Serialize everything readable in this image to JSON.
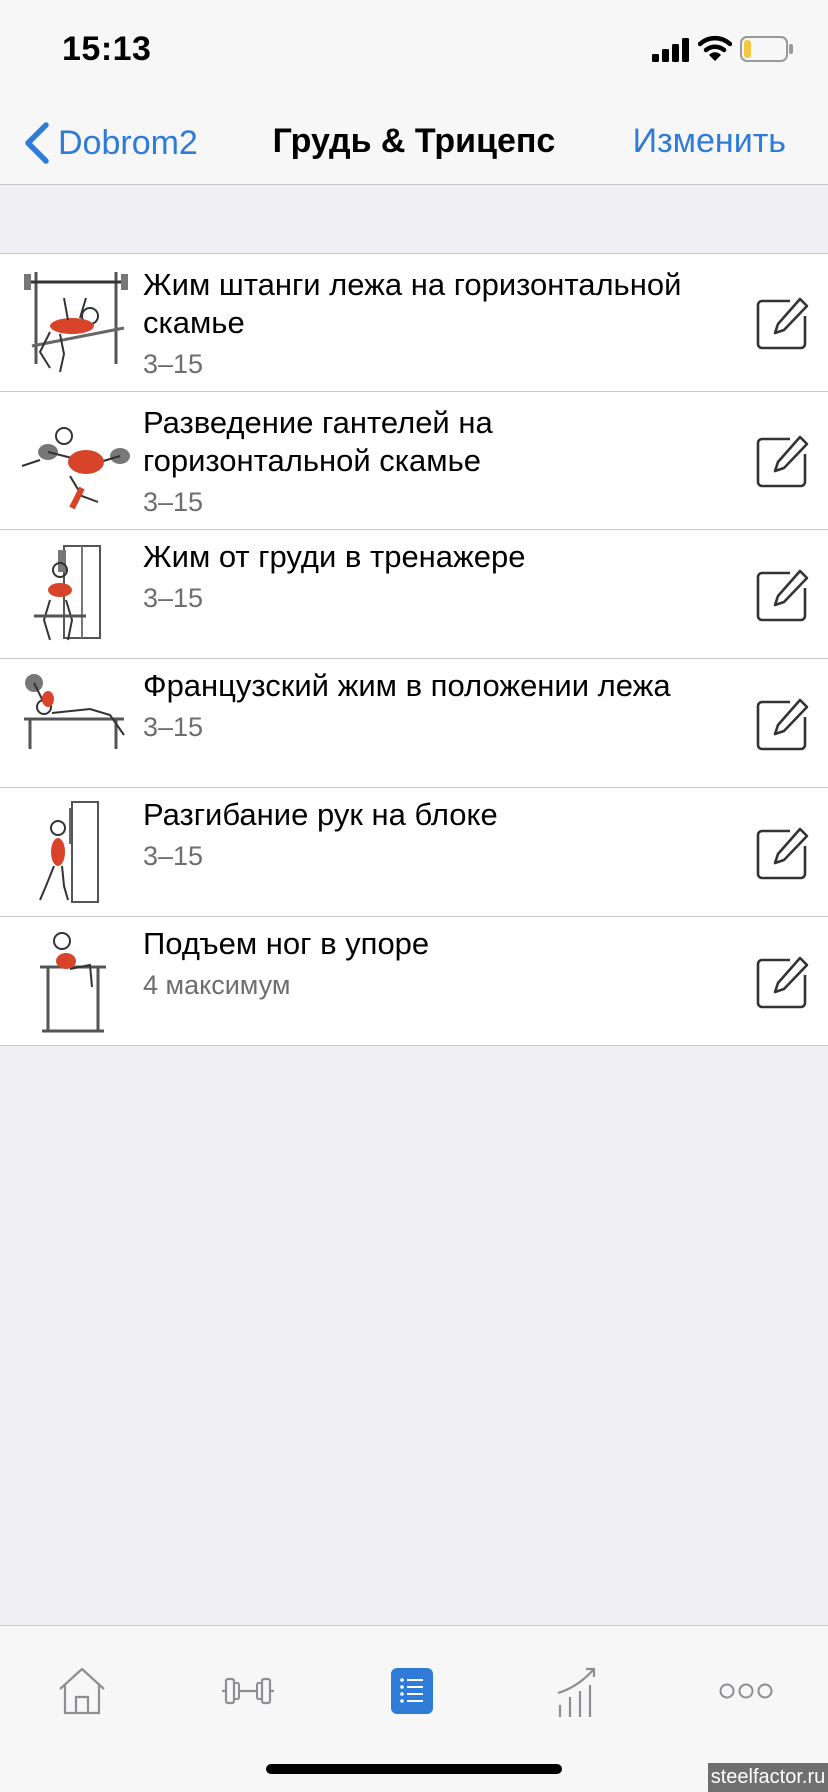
{
  "status_bar": {
    "time": "15:13",
    "battery_color": "#f5c842"
  },
  "nav": {
    "back_label": "Dobrom2",
    "title": "Грудь & Трицепс",
    "edit_label": "Изменить",
    "accent_color": "#2f7bd8"
  },
  "exercises": [
    {
      "name": "Жим штанги лежа на горизонтальной скамье",
      "sets": "3–15",
      "icon": "barbell-bench-press-illustration"
    },
    {
      "name": "Разведение гантелей на горизонтальной скамье",
      "sets": "3–15",
      "icon": "dumbbell-fly-illustration"
    },
    {
      "name": "Жим от груди в тренажере",
      "sets": "3–15",
      "icon": "machine-chest-press-illustration"
    },
    {
      "name": "Французский жим в положении лежа",
      "sets": "3–15",
      "icon": "lying-triceps-extension-illustration"
    },
    {
      "name": "Разгибание рук на блоке",
      "sets": "3–15",
      "icon": "cable-pushdown-illustration"
    },
    {
      "name": "Подъем ног в упоре",
      "sets": "4 максимум",
      "icon": "leg-raise-illustration"
    }
  ],
  "tabs": [
    {
      "icon": "home-icon"
    },
    {
      "icon": "dumbbell-icon"
    },
    {
      "icon": "list-icon",
      "active": true
    },
    {
      "icon": "progress-chart-icon"
    },
    {
      "icon": "more-icon"
    }
  ],
  "watermark": "steelfactor.ru"
}
